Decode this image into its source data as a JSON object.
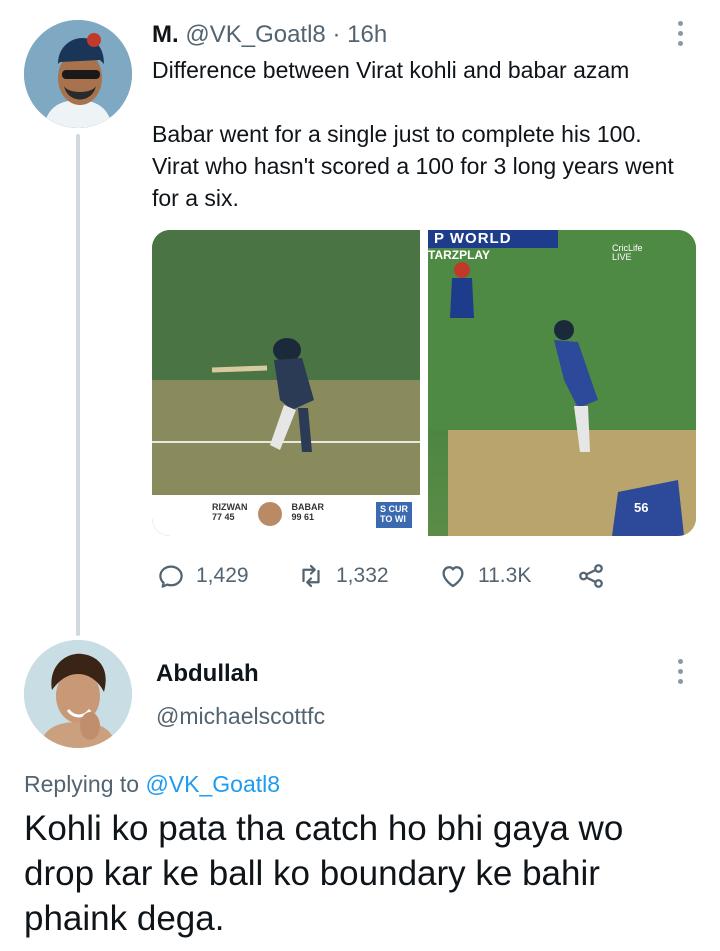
{
  "tweet": {
    "author_name": "M.",
    "author_handle": "@VK_Goatl8",
    "separator": "·",
    "time": "16h",
    "text_line1": "Difference between Virat kohli and babar azam",
    "text_line2": "Babar went for a single just to complete his 100. Virat who hasn't scored a 100 for 3 long years went for a six.",
    "media": {
      "left": {
        "scorebar_player1": "RIZWAN",
        "scorebar_player1_score": "77 45",
        "scorebar_player2": "BABAR",
        "scorebar_player2_score": "99 61",
        "scorebar_extra1": "S CUR",
        "scorebar_extra2": "TO WI"
      },
      "right": {
        "banner_top": "P WORLD",
        "banner_sponsor": "TARZPLAY",
        "corner_brand1": "CricLife",
        "corner_brand2": "LIVE",
        "jersey_number": "56"
      }
    },
    "actions": {
      "reply_count": "1,429",
      "retweet_count": "1,332",
      "like_count": "11.3K"
    }
  },
  "reply": {
    "author_name": "Abdullah",
    "author_handle": "@michaelscottfc",
    "replying_prefix": "Replying to",
    "replying_to": "@VK_Goatl8",
    "text": "Kohli ko pata tha catch ho bhi gaya wo drop kar ke ball ko boundary ke bahir phaink dega."
  },
  "colors": {
    "text_primary": "#0f1419",
    "text_secondary": "#536471",
    "link": "#1d9bf0",
    "thread_line": "#cfd9de"
  },
  "icons": [
    "more-icon",
    "reply-icon",
    "retweet-icon",
    "like-icon",
    "share-icon"
  ]
}
